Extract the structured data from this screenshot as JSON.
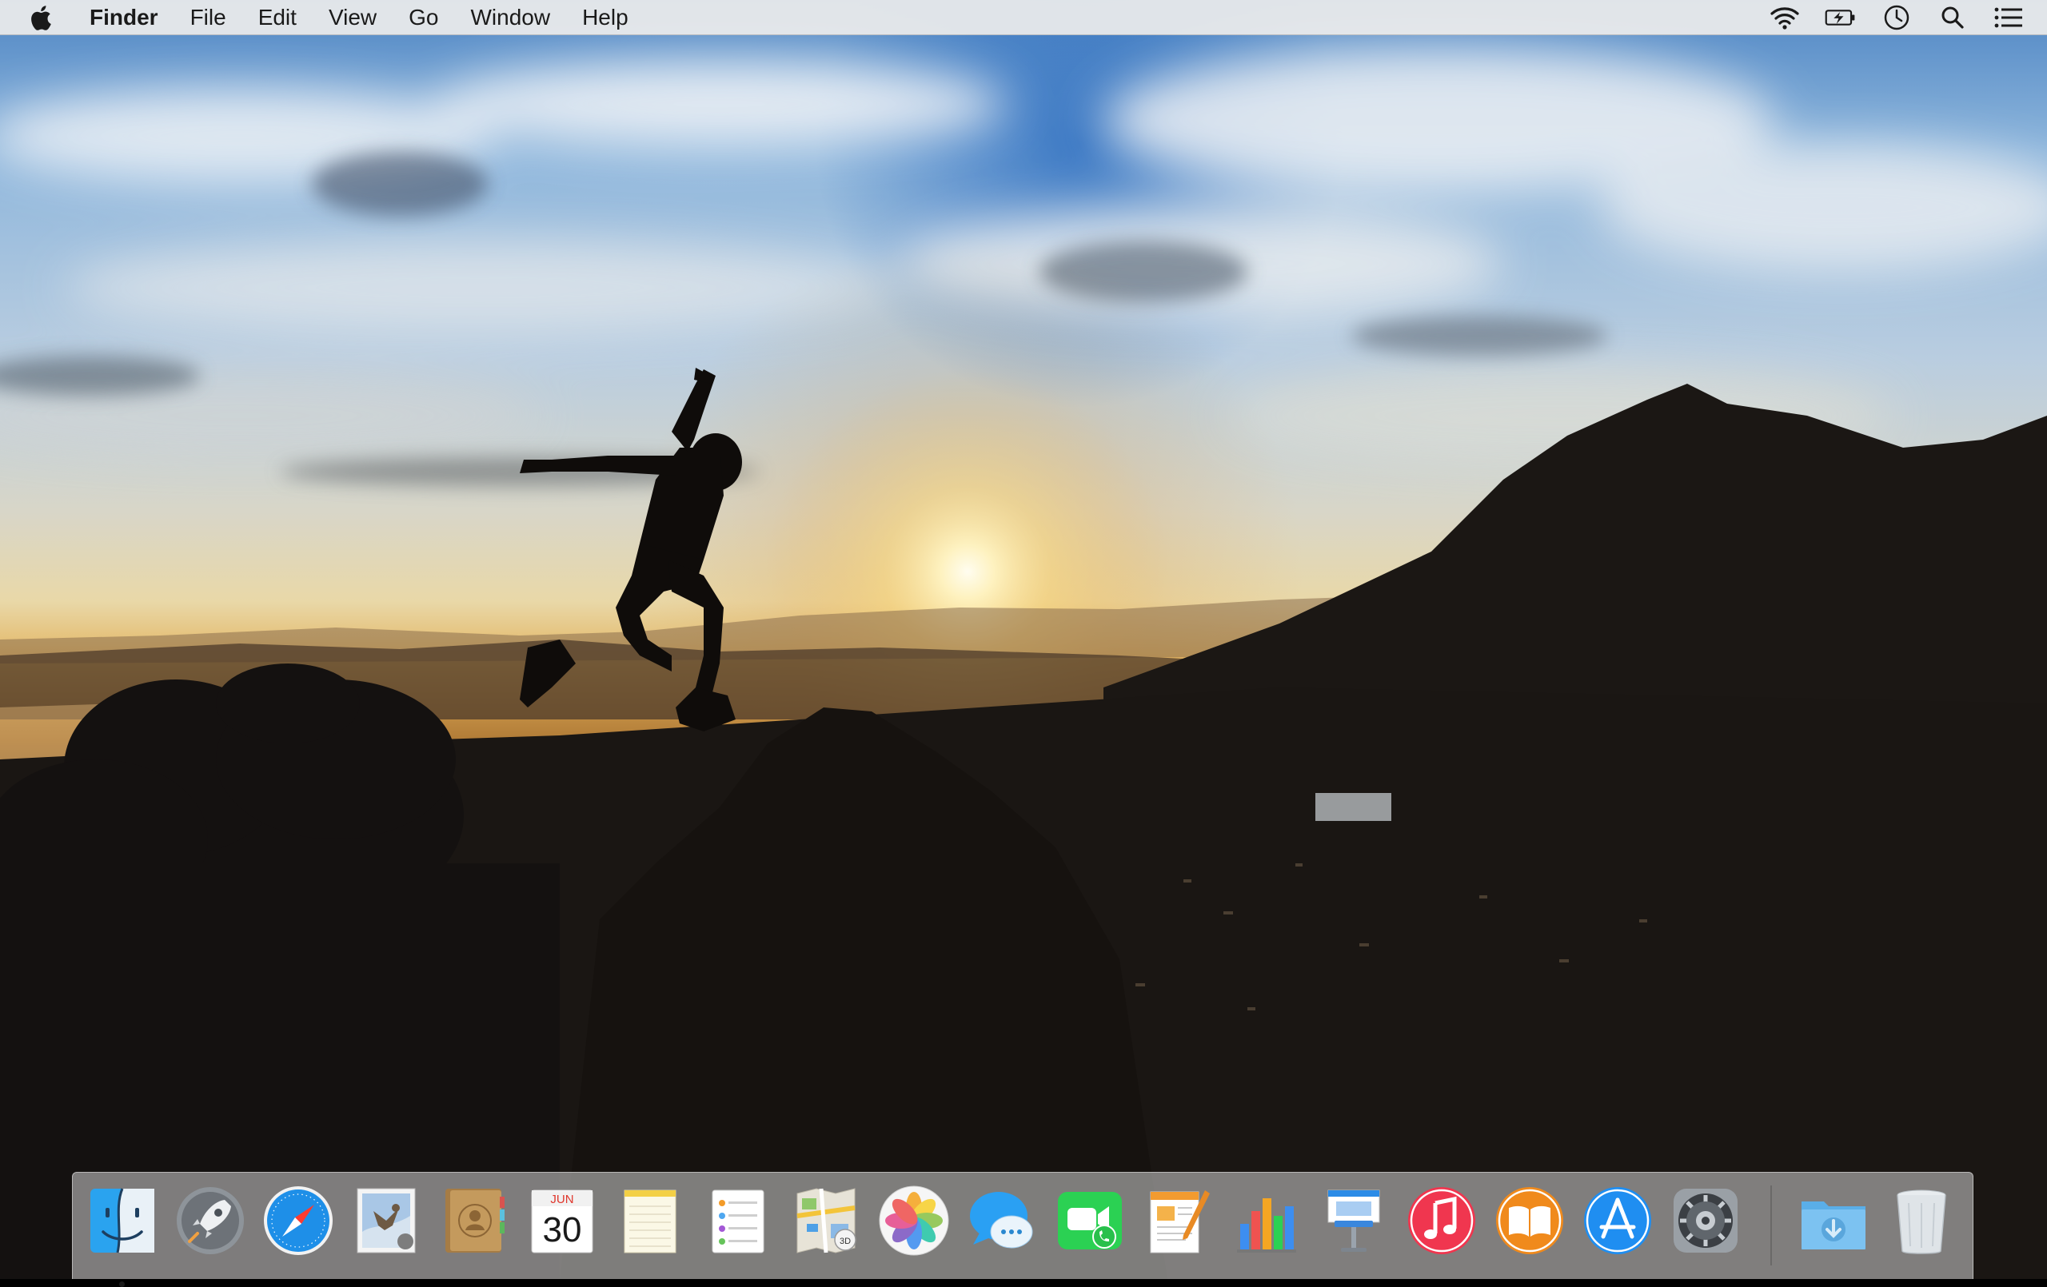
{
  "menubar": {
    "apple_icon": "apple-logo",
    "app_name": "Finder",
    "menus": [
      "File",
      "Edit",
      "View",
      "Go",
      "Window",
      "Help"
    ],
    "status_icons": [
      "wifi-icon",
      "battery-charging-icon",
      "clock-icon",
      "spotlight-search-icon",
      "notification-center-icon"
    ]
  },
  "dock": {
    "apps": [
      {
        "name": "Finder",
        "icon": "finder-icon",
        "running": true
      },
      {
        "name": "Launchpad",
        "icon": "launchpad-icon"
      },
      {
        "name": "Safari",
        "icon": "safari-icon"
      },
      {
        "name": "Mail",
        "icon": "mail-icon"
      },
      {
        "name": "Contacts",
        "icon": "contacts-icon"
      },
      {
        "name": "Calendar",
        "icon": "calendar-icon",
        "month": "JUN",
        "day": "30"
      },
      {
        "name": "Notes",
        "icon": "notes-icon"
      },
      {
        "name": "Reminders",
        "icon": "reminders-icon"
      },
      {
        "name": "Maps",
        "icon": "maps-icon",
        "badge": "3D"
      },
      {
        "name": "Photos",
        "icon": "photos-icon"
      },
      {
        "name": "Messages",
        "icon": "messages-icon"
      },
      {
        "name": "FaceTime",
        "icon": "facetime-icon"
      },
      {
        "name": "Pages",
        "icon": "pages-icon"
      },
      {
        "name": "Numbers",
        "icon": "numbers-icon"
      },
      {
        "name": "Keynote",
        "icon": "keynote-icon"
      },
      {
        "name": "iTunes",
        "icon": "itunes-icon"
      },
      {
        "name": "iBooks",
        "icon": "ibooks-icon"
      },
      {
        "name": "App Store",
        "icon": "app-store-icon"
      },
      {
        "name": "System Preferences",
        "icon": "system-preferences-icon"
      }
    ],
    "stacks": [
      {
        "name": "Downloads",
        "icon": "downloads-folder-icon"
      },
      {
        "name": "Trash",
        "icon": "trash-icon"
      }
    ]
  }
}
